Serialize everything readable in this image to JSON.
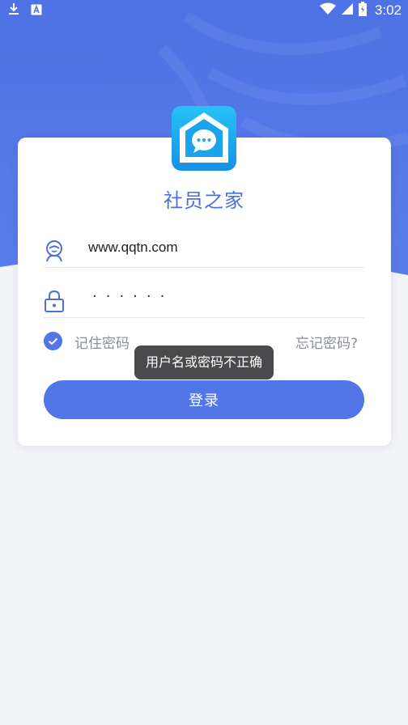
{
  "status_bar": {
    "time": "3:02",
    "icons": [
      "download-icon",
      "keyboard-a-icon",
      "wifi-icon",
      "signal-icon",
      "battery-icon"
    ]
  },
  "app": {
    "title": "社员之家",
    "logo_icon": "chat-house-icon"
  },
  "login_form": {
    "username_value": "www.qqtn.com",
    "password_mask": "······",
    "remember_label": "记住密码",
    "remember_checked": true,
    "forgot_label": "忘记密码?",
    "login_button_label": "登录"
  },
  "toast": {
    "message": "用户名或密码不正确"
  },
  "colors": {
    "primary": "#5275e8",
    "title": "#4e6fd6",
    "background": "#f3f4f8",
    "muted_text": "#8a8e99"
  }
}
